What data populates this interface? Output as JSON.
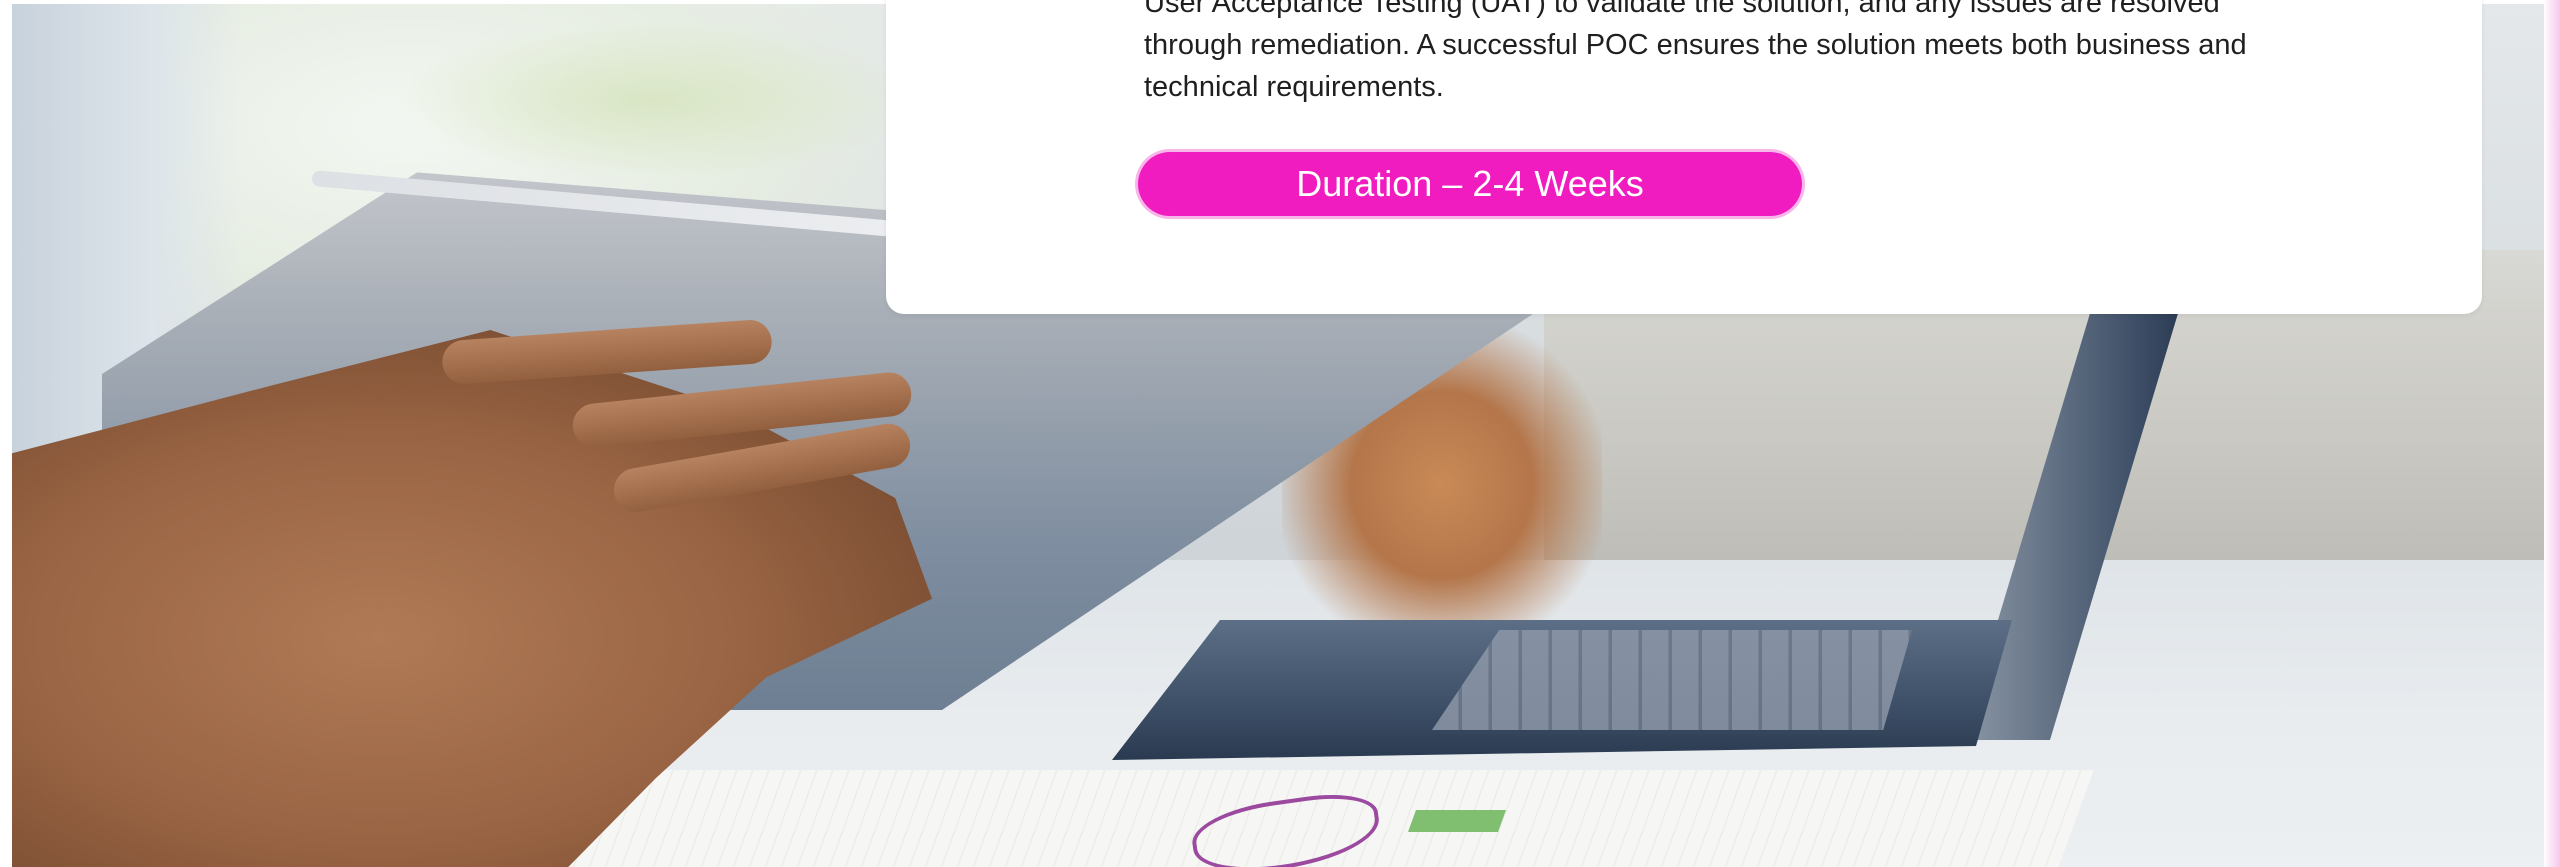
{
  "slide": {
    "description_lines": [
      "User Acceptance Testing (UAT) to validate the solution, and any issues are resolved",
      "through remediation. A successful POC ensures the solution meets both business and",
      "technical requirements."
    ],
    "duration_label": "Duration – 2-4 Weeks"
  },
  "colors": {
    "accent": "#f01cc0",
    "card_background": "#ffffff",
    "body_text": "#1f1f1f"
  }
}
